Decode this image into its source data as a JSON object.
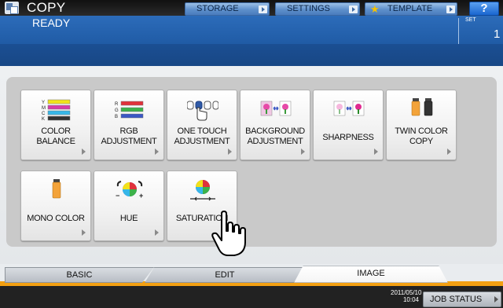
{
  "header": {
    "title": "COPY",
    "buttons": {
      "storage": "STORAGE",
      "settings": "SETTINGS",
      "template": "TEMPLATE",
      "help": "?"
    }
  },
  "status": {
    "message": "READY",
    "set_label": "SET",
    "set_value": "1"
  },
  "functions": [
    {
      "label": "COLOR\nBALANCE",
      "icon": "color-balance-icon"
    },
    {
      "label": "RGB\nADJUSTMENT",
      "icon": "rgb-adjustment-icon"
    },
    {
      "label": "ONE TOUCH\nADJUSTMENT",
      "icon": "one-touch-icon"
    },
    {
      "label": "BACKGROUND\nADJUSTMENT",
      "icon": "background-icon"
    },
    {
      "label": "SHARPNESS",
      "icon": "sharpness-icon"
    },
    {
      "label": "TWIN COLOR\nCOPY",
      "icon": "twin-color-icon"
    },
    {
      "label": "MONO COLOR",
      "icon": "mono-color-icon"
    },
    {
      "label": "HUE",
      "icon": "hue-icon"
    },
    {
      "label": "SATURATION",
      "icon": "saturation-icon"
    }
  ],
  "icon_text": {
    "ymck": [
      "Y",
      "M",
      "C",
      "K"
    ],
    "rgb": [
      "R",
      "G",
      "B"
    ],
    "minus": "−",
    "plus": "+"
  },
  "tabs": [
    {
      "label": "BASIC",
      "active": false
    },
    {
      "label": "EDIT",
      "active": false
    },
    {
      "label": "IMAGE",
      "active": true
    }
  ],
  "footer": {
    "date": "2011/05/10",
    "time": "10:04",
    "job_status": "JOB STATUS"
  },
  "colors": {
    "status_blue": "#1f5aa4",
    "accent_orange": "#f3a012",
    "button_blue": "#5d8fcb"
  }
}
